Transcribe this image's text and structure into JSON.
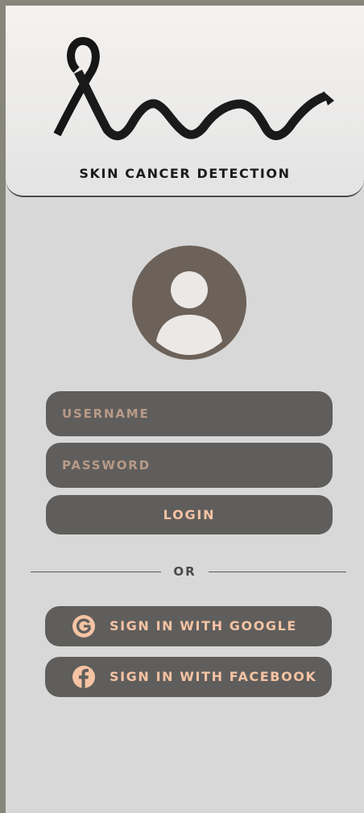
{
  "header": {
    "title": "SKIN CANCER DETECTION",
    "logo_icon": "awareness-ribbon-icon"
  },
  "avatar": {
    "icon": "user-avatar-icon"
  },
  "login_form": {
    "username_placeholder": "USERNAME",
    "password_placeholder": "PASSWORD",
    "login_label": "LOGIN"
  },
  "divider": {
    "text": "OR"
  },
  "social": {
    "google_label": "SIGN IN WITH GOOGLE",
    "google_icon": "google-icon",
    "facebook_label": "SIGN IN WITH FACEBOOK",
    "facebook_icon": "facebook-icon"
  },
  "colors": {
    "window_frame": "#86867b",
    "screen_background": "#d8d8d8",
    "button_background": "#5f5e5c",
    "accent_text": "#f6c3a3",
    "placeholder_text": "#b89a87",
    "avatar": "#6c6259"
  }
}
